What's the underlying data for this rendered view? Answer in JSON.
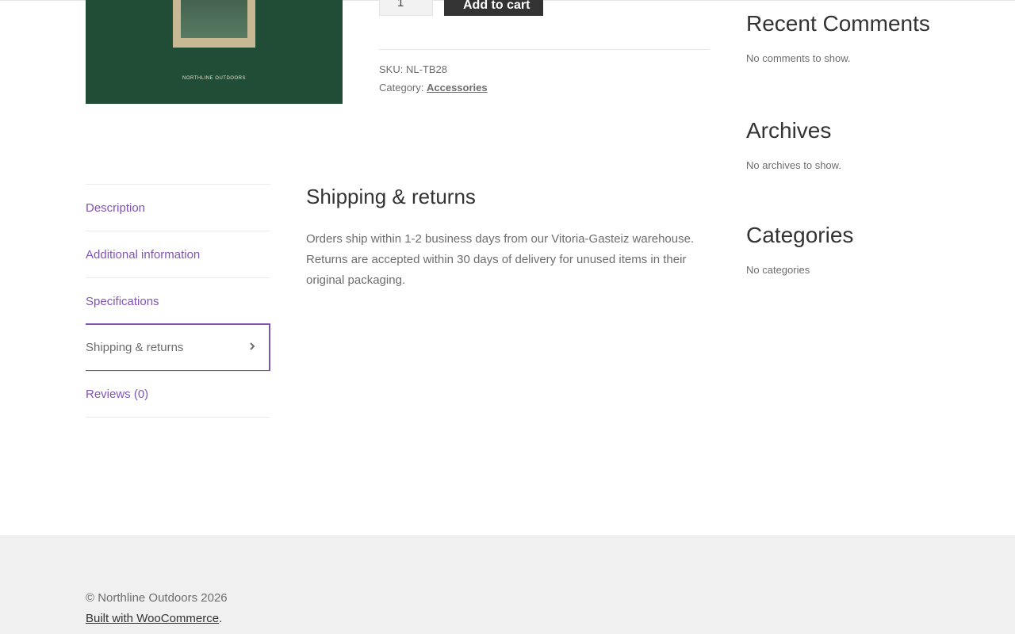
{
  "product": {
    "image_brand_text": "NORTHLINE OUTDOORS",
    "quantity_value": "1",
    "add_to_cart_label": "Add to cart",
    "sku_label": "SKU:",
    "sku_value": "NL-TB28",
    "category_label": "Category:",
    "category_value": "Accessories",
    "colors": {
      "image_bg": "#214d36",
      "button_bg": "#333333",
      "accent": "#7f54b3"
    }
  },
  "tabs": {
    "items": [
      {
        "label": "Description"
      },
      {
        "label": "Additional information"
      },
      {
        "label": "Specifications"
      },
      {
        "label": "Shipping & returns",
        "active": true,
        "icon": "chevron-right-icon"
      },
      {
        "label": "Reviews (0)"
      }
    ]
  },
  "panel": {
    "title": "Shipping & returns",
    "body": "Orders ship within 1-2 business days from our Vitoria-Gasteiz warehouse. Returns are accepted within 30 days of delivery for unused items in their original packaging."
  },
  "sidebar": {
    "recent_comments": {
      "title": "Recent Comments",
      "text": "No comments to show."
    },
    "archives": {
      "title": "Archives",
      "text": "No archives to show."
    },
    "categories": {
      "title": "Categories",
      "text": "No categories"
    }
  },
  "footer": {
    "copyright": "© Northline Outdoors 2026",
    "credit_link": "Built with WooCommerce",
    "credit_suffix": "."
  }
}
